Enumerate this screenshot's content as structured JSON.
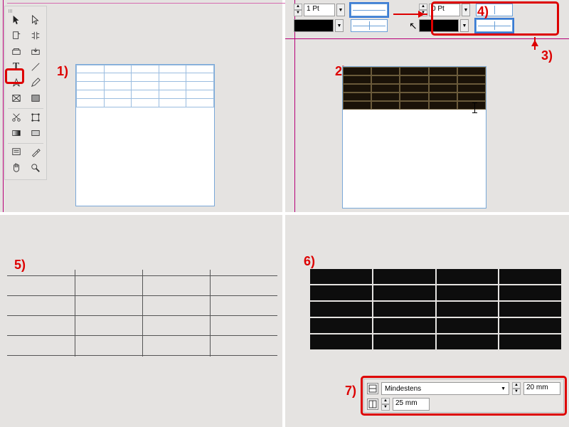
{
  "steps": {
    "s1": "1)",
    "s2": "2)",
    "s3": "3)",
    "s4": "4)",
    "s5": "5)",
    "s6": "6)",
    "s7": "7)"
  },
  "stroke_panel_left": {
    "weight": "1 Pt"
  },
  "stroke_panel_right": {
    "weight": "0 Pt"
  },
  "row_height_panel": {
    "mode": "Mindestens",
    "height_value": "20 mm",
    "width_value": "25 mm"
  },
  "tables": {
    "q1_rows": 5,
    "q1_cols": 5,
    "q2_rows": 5,
    "q2_cols": 5,
    "q4_rows": 5,
    "q4_cols": 4
  }
}
